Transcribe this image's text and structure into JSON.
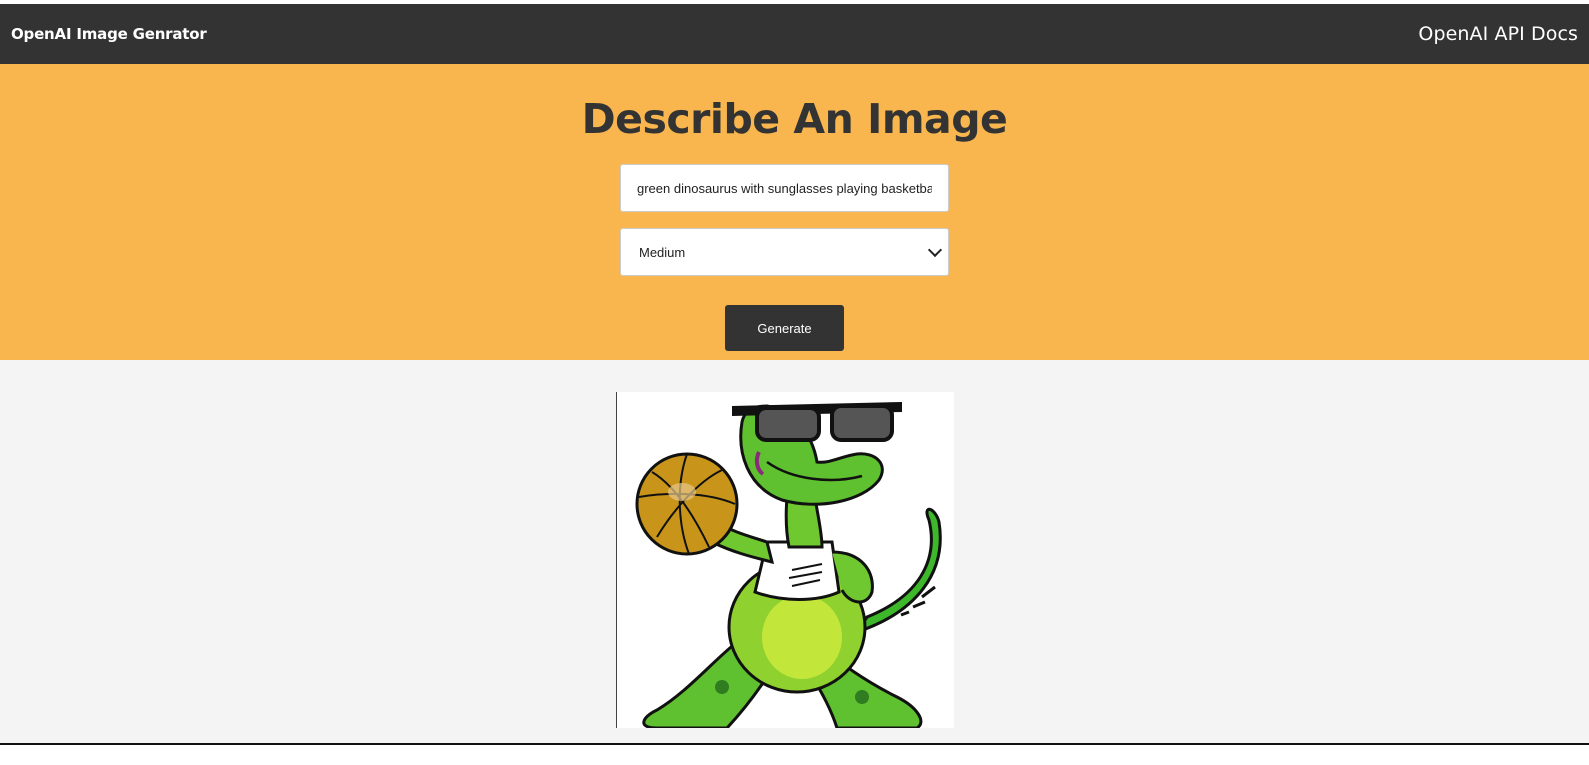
{
  "navbar": {
    "brand": "OpenAI Image Genrator",
    "docs_link": "OpenAI API Docs"
  },
  "hero": {
    "title": "Describe An Image",
    "prompt_value": "green dinosaurus with sunglasses playing basketba",
    "size_selected": "Medium",
    "generate_label": "Generate"
  },
  "colors": {
    "navbar_bg": "#333333",
    "hero_bg": "#f9b64e",
    "page_bg": "#f4f4f4",
    "button_bg": "#333333"
  },
  "result": {
    "image_subject": "green dinosaur with sunglasses holding a basketball"
  }
}
